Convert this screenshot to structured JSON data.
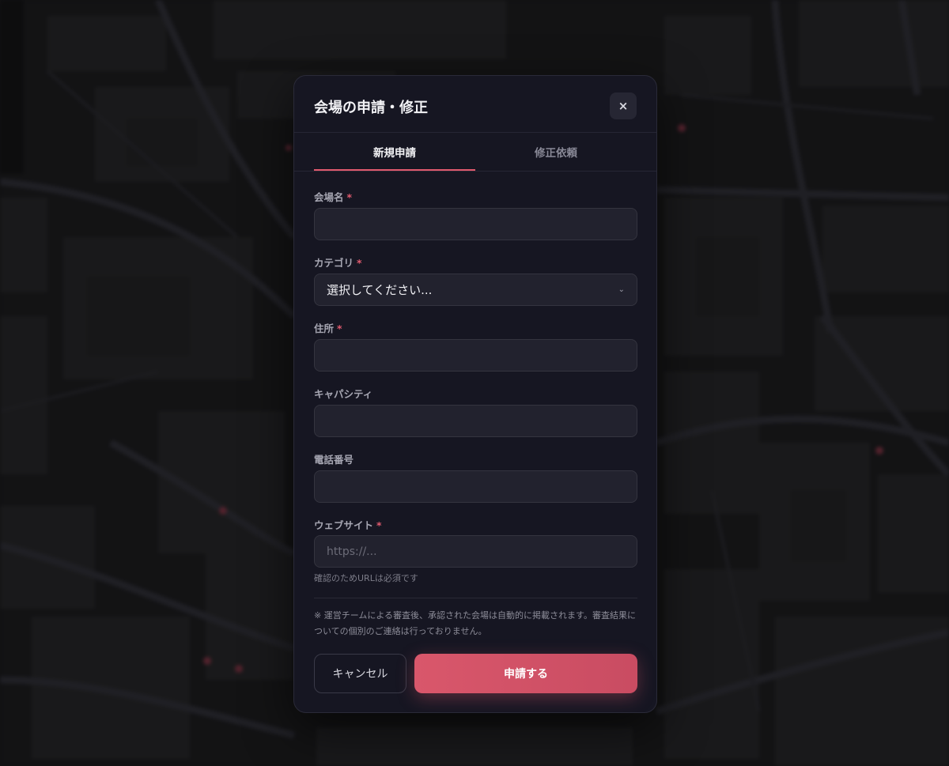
{
  "modal": {
    "title": "会場の申請・修正",
    "close_icon": "×"
  },
  "tabs": [
    {
      "label": "新規申請",
      "active": true
    },
    {
      "label": "修正依頼",
      "active": false
    }
  ],
  "form": {
    "venue_name": {
      "label": "会場名",
      "required_mark": "*",
      "value": ""
    },
    "category": {
      "label": "カテゴリ",
      "required_mark": "*",
      "selected": "選択してください...",
      "chevron": "⌄"
    },
    "address": {
      "label": "住所",
      "required_mark": "*",
      "value": ""
    },
    "capacity": {
      "label": "キャパシティ",
      "value": ""
    },
    "phone": {
      "label": "電話番号",
      "value": ""
    },
    "website": {
      "label": "ウェブサイト",
      "required_mark": "*",
      "placeholder": "https://...",
      "hint": "確認のためURLは必須です"
    }
  },
  "notice": "※ 運営チームによる審査後、承認された会場は自動的に掲載されます。審査結果についての個別のご連絡は行っておりません。",
  "buttons": {
    "cancel": "キャンセル",
    "submit": "申請する"
  },
  "colors": {
    "accent": "#e05a6e",
    "modal_bg": "#161622",
    "input_bg": "#22222e"
  }
}
